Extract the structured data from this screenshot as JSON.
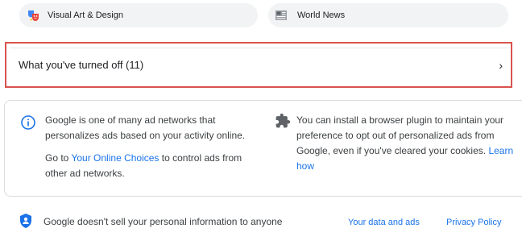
{
  "topics": [
    {
      "label": "Visual Art & Design",
      "icon": "theater-masks-icon"
    },
    {
      "label": "World News",
      "icon": "newspaper-icon"
    }
  ],
  "turned_off": {
    "label": "What you've turned off (11)",
    "chevron": "›"
  },
  "info": {
    "left_p1": "Google is one of many ad networks that personalizes ads based on your activity online.",
    "left_p2_prefix": "Go to ",
    "left_p2_link": "Your Online Choices",
    "left_p2_suffix": " to control ads from other ad networks.",
    "right_text": "You can install a browser plugin to maintain your preference to opt out of personalized ads from Google, even if you've cleared your cookies. ",
    "right_link": "Learn how"
  },
  "footer": {
    "text": "Google doesn't sell your personal information to anyone",
    "link_data": "Your data and ads",
    "link_privacy": "Privacy Policy"
  },
  "colors": {
    "accent": "#1a73e8",
    "highlight_border": "#d9534f",
    "chip_bg": "#f1f3f4"
  }
}
